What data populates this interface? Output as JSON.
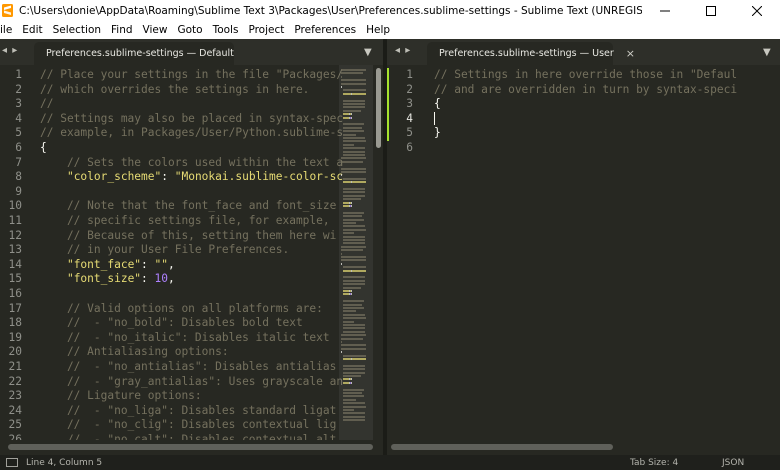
{
  "window": {
    "title": "C:\\Users\\donie\\AppData\\Roaming\\Sublime Text 3\\Packages\\User\\Preferences.sublime-settings - Sublime Text (UNREGISTERED)",
    "app_icon": "sublime-text-icon",
    "controls": [
      "minimize-icon",
      "maximize-icon",
      "close-icon"
    ]
  },
  "menu": [
    "ile",
    "Edit",
    "Selection",
    "Find",
    "View",
    "Goto",
    "Tools",
    "Project",
    "Preferences",
    "Help"
  ],
  "left_pane": {
    "tab_label": "Preferences.sublime-settings — Default",
    "nav_arrows": "◂ ▸",
    "dropdown": "▼",
    "line_numbers": [
      "1",
      "2",
      "3",
      "4",
      "5",
      "6",
      "7",
      "8",
      "9",
      "10",
      "11",
      "12",
      "13",
      "14",
      "15",
      "16",
      "17",
      "18",
      "19",
      "20",
      "21",
      "22",
      "23",
      "24",
      "25",
      "26"
    ],
    "lines": [
      [
        {
          "t": "// Place your settings in the file \"Packages/",
          "c": "comment"
        }
      ],
      [
        {
          "t": "// which overrides the settings in here.",
          "c": "comment"
        }
      ],
      [
        {
          "t": "//",
          "c": "comment"
        }
      ],
      [
        {
          "t": "// Settings may also be placed in syntax-spec",
          "c": "comment"
        }
      ],
      [
        {
          "t": "// example, in Packages/User/Python.sublime-s",
          "c": "comment"
        }
      ],
      [
        {
          "t": "{",
          "c": "punct"
        }
      ],
      [
        {
          "t": "    // Sets the colors used within the text a",
          "c": "comment"
        }
      ],
      [
        {
          "t": "    ",
          "c": "punct"
        },
        {
          "t": "\"color_scheme\"",
          "c": "string"
        },
        {
          "t": ": ",
          "c": "punct"
        },
        {
          "t": "\"Monokai.sublime-color-sc",
          "c": "string"
        }
      ],
      [
        {
          "t": "",
          "c": "punct"
        }
      ],
      [
        {
          "t": "    // Note that the font_face and font_size",
          "c": "comment"
        }
      ],
      [
        {
          "t": "    // specific settings file, for example, ",
          "c": "comment"
        }
      ],
      [
        {
          "t": "    // Because of this, setting them here wi",
          "c": "comment"
        }
      ],
      [
        {
          "t": "    // in your User File Preferences.",
          "c": "comment"
        }
      ],
      [
        {
          "t": "    ",
          "c": "punct"
        },
        {
          "t": "\"font_face\"",
          "c": "string"
        },
        {
          "t": ": ",
          "c": "punct"
        },
        {
          "t": "\"\"",
          "c": "string"
        },
        {
          "t": ",",
          "c": "punct"
        }
      ],
      [
        {
          "t": "    ",
          "c": "punct"
        },
        {
          "t": "\"font_size\"",
          "c": "string"
        },
        {
          "t": ": ",
          "c": "punct"
        },
        {
          "t": "10",
          "c": "number"
        },
        {
          "t": ",",
          "c": "punct"
        }
      ],
      [
        {
          "t": "",
          "c": "punct"
        }
      ],
      [
        {
          "t": "    // Valid options on all platforms are:",
          "c": "comment"
        }
      ],
      [
        {
          "t": "    //  - \"no_bold\": Disables bold text",
          "c": "comment"
        }
      ],
      [
        {
          "t": "    //  - \"no_italic\": Disables italic text",
          "c": "comment"
        }
      ],
      [
        {
          "t": "    // Antialiasing options:",
          "c": "comment"
        }
      ],
      [
        {
          "t": "    //  - \"no_antialias\": Disables antialias",
          "c": "comment"
        }
      ],
      [
        {
          "t": "    //  - \"gray_antialias\": Uses grayscale an",
          "c": "comment"
        }
      ],
      [
        {
          "t": "    // Ligature options:",
          "c": "comment"
        }
      ],
      [
        {
          "t": "    //  - \"no_liga\": Disables standard ligat",
          "c": "comment"
        }
      ],
      [
        {
          "t": "    //  - \"no_clig\": Disables contextual lig",
          "c": "comment"
        }
      ],
      [
        {
          "t": "    //  - \"no_calt\": Disables contextual alt",
          "c": "comment"
        }
      ]
    ]
  },
  "right_pane": {
    "tab_label": "Preferences.sublime-settings — User",
    "nav_arrows": "◂ ▸",
    "dropdown": "▼",
    "line_numbers": [
      "1",
      "2",
      "3",
      "4",
      "5",
      "6"
    ],
    "current_line": 4,
    "lines": [
      [
        {
          "t": "// Settings in here override those in \"Defaul",
          "c": "comment"
        }
      ],
      [
        {
          "t": "// and are overridden in turn by syntax-speci",
          "c": "comment"
        }
      ],
      [
        {
          "t": "{",
          "c": "punct"
        }
      ],
      [
        {
          "t": "",
          "c": "punct"
        }
      ],
      [
        {
          "t": "}",
          "c": "punct"
        }
      ],
      [
        {
          "t": "",
          "c": "punct"
        }
      ]
    ]
  },
  "tab_close_glyph": "×",
  "status": {
    "position": "Line 4, Column 5",
    "tab_size": "Tab Size: 4",
    "syntax": "JSON"
  },
  "colors": {
    "background": "#272822",
    "comment": "#75715e",
    "string": "#e6db74",
    "number": "#ae81ff",
    "text": "#f8f8f2",
    "modified_marker": "#a6e22e"
  }
}
